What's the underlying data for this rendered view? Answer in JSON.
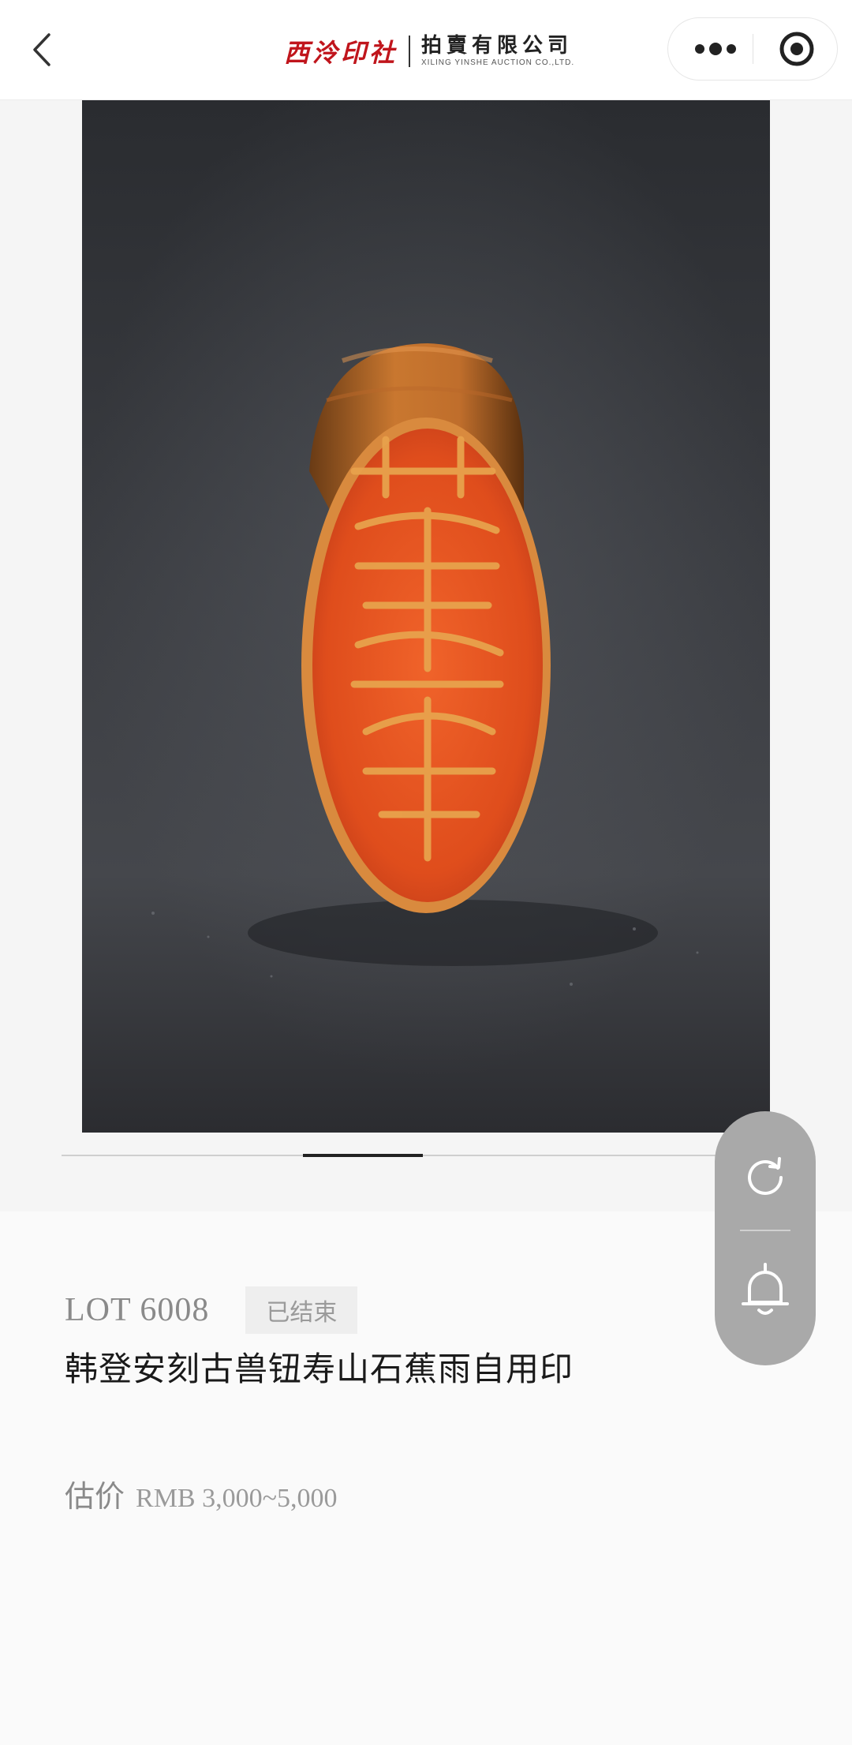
{
  "header": {
    "logo": {
      "brand": "西泠印社",
      "company": "拍賣有限公司",
      "company_en": "XILING YINSHE AUCTION CO.,LTD."
    },
    "icons": {
      "back": "back-chevron-icon",
      "more": "more-dots-icon",
      "close": "target-close-icon"
    }
  },
  "gallery": {
    "image": "orange seal stone carved face, dark grey background",
    "current_slide": 3,
    "slide_count": 6
  },
  "floating_panel": {
    "icons": [
      "refresh-icon",
      "bell-icon"
    ]
  },
  "lot": {
    "number": "LOT 6008",
    "status": "已结束",
    "title": "韩登安刻古兽钮寿山石蕉雨自用印",
    "estimate_label": "估价",
    "estimate_value": "RMB 3,000~5,000"
  },
  "colors": {
    "brand_red": "#c0151c",
    "seal_orange": "#e2511e",
    "panel_grey": "#a9a9a9"
  }
}
